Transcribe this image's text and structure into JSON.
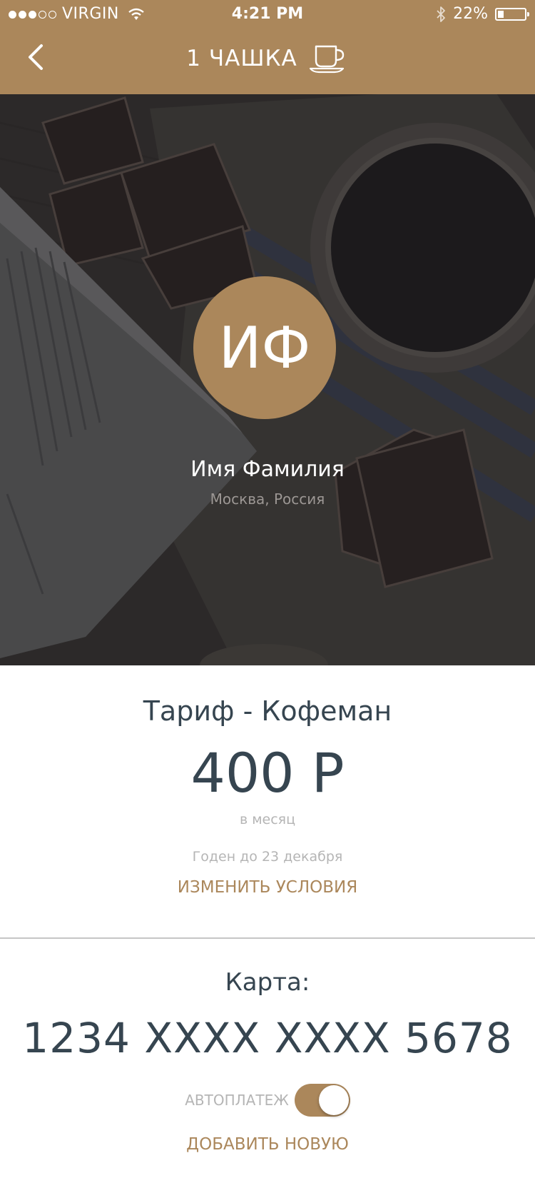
{
  "status_bar": {
    "carrier": "VIRGIN",
    "time": "4:21 PM",
    "battery": "22%",
    "battery_level": 0.22,
    "signal_bars": 3,
    "signal_total": 5
  },
  "nav": {
    "title": "1 ЧАШКА",
    "back_icon": "chevron-left-icon",
    "title_icon": "coffee-cup-icon"
  },
  "profile": {
    "initials": "ИФ",
    "name": "Имя Фамилия",
    "location": "Москва, Россия"
  },
  "tariff": {
    "title": "Тариф - Кофеман",
    "price": "400 Р",
    "period": "в месяц",
    "valid_until": "Годен до 23 декабря",
    "change_label": "ИЗМЕНИТЬ УСЛОВИЯ"
  },
  "card": {
    "label": "Карта:",
    "number": "1234 XXXX XXXX 5678",
    "autopay_label": "АВТОПЛАТЕЖ",
    "autopay_enabled": true,
    "add_label": "ДОБАВИТЬ НОВУЮ"
  },
  "colors": {
    "accent": "#ab875b",
    "text_dark": "#364550",
    "text_muted": "#b5b5b5"
  }
}
